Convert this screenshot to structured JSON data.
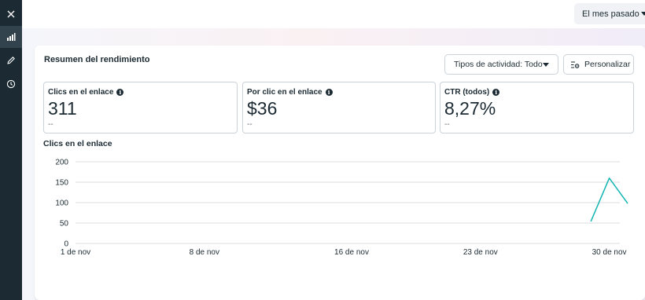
{
  "sidebar": {
    "items": [
      {
        "icon": "close-icon"
      },
      {
        "icon": "bar-chart-icon",
        "active": true
      },
      {
        "icon": "pencil-icon"
      },
      {
        "icon": "clock-icon"
      }
    ]
  },
  "topbar": {
    "period_select": "El mes pasado"
  },
  "card": {
    "title": "Resumen del rendimiento",
    "activity_button": "Tipos de actividad: Todo",
    "customize_button": "Personalizar"
  },
  "metrics": [
    {
      "label": "Clics en el enlace",
      "value": "311",
      "compare": "--"
    },
    {
      "label": "Por clic en el enlace",
      "value": "$36",
      "compare": "--"
    },
    {
      "label": "CTR (todos)",
      "value": "8,27%",
      "compare": "--"
    }
  ],
  "colors": {
    "sidebar_bg": "#1c2b33",
    "line": "#12b5b0",
    "grid": "#dadde1"
  },
  "chart_data": {
    "type": "line",
    "title": "Clics en el enlace",
    "ylim": [
      0,
      200
    ],
    "yticks": [
      "0",
      "50",
      "100",
      "150",
      "200"
    ],
    "xlim": [
      1,
      31
    ],
    "xticks": [
      {
        "day": 1,
        "label": "1 de nov"
      },
      {
        "day": 8,
        "label": "8 de nov"
      },
      {
        "day": 16,
        "label": "16 de nov"
      },
      {
        "day": 23,
        "label": "23 de nov"
      },
      {
        "day": 30,
        "label": "30 de nov"
      }
    ],
    "series": [
      {
        "x": [
          29,
          30,
          31
        ],
        "values": [
          54,
          160,
          98
        ]
      }
    ],
    "grid": true
  }
}
